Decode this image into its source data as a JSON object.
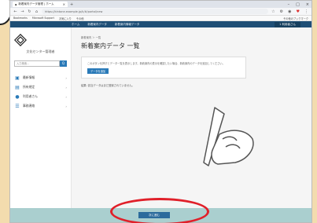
{
  "browser": {
    "tab_title": "新着案内データ管理 | ホーム",
    "url": "https://kintone.example.jp/k/#/portal/new",
    "bookmarks": [
      "Bookmarks",
      "Microsoft Support",
      "お気に入り",
      "その他"
    ],
    "bookmarks_right": "その他のブックマーク"
  },
  "app": {
    "menu": [
      "ホーム",
      "新着案内データ",
      "新着案内情報データ"
    ],
    "user_label": "1 利用者さん",
    "org_name": "文化センター管理者",
    "search_placeholder": "入力検索...",
    "search_button": "Q",
    "nav": [
      {
        "label": "最新情報",
        "icon": "▣"
      },
      {
        "label": "所有規定",
        "icon": "▤"
      },
      {
        "label": "利用者さん",
        "icon": "●"
      },
      {
        "label": "事務連絡",
        "icon": "☰"
      }
    ]
  },
  "main": {
    "breadcrumb": "新着案内  ＞  一覧",
    "title": "新着案内データ 一覧",
    "info_text": "このボタンを押すとデータ一覧を表示します。新着案内の表示を確認したい場合、新着案内のデータを追加してください。",
    "command_button": "データを追加",
    "result_text": "結果: 該当データはまだ登録されていません。"
  },
  "footer": {
    "submit_label": "次に進む"
  },
  "colors": {
    "header": "#1f4f76",
    "accent": "#2a7ab8",
    "footer": "#aacfcf",
    "highlight": "#e0202a",
    "background": "#f3dcae"
  }
}
